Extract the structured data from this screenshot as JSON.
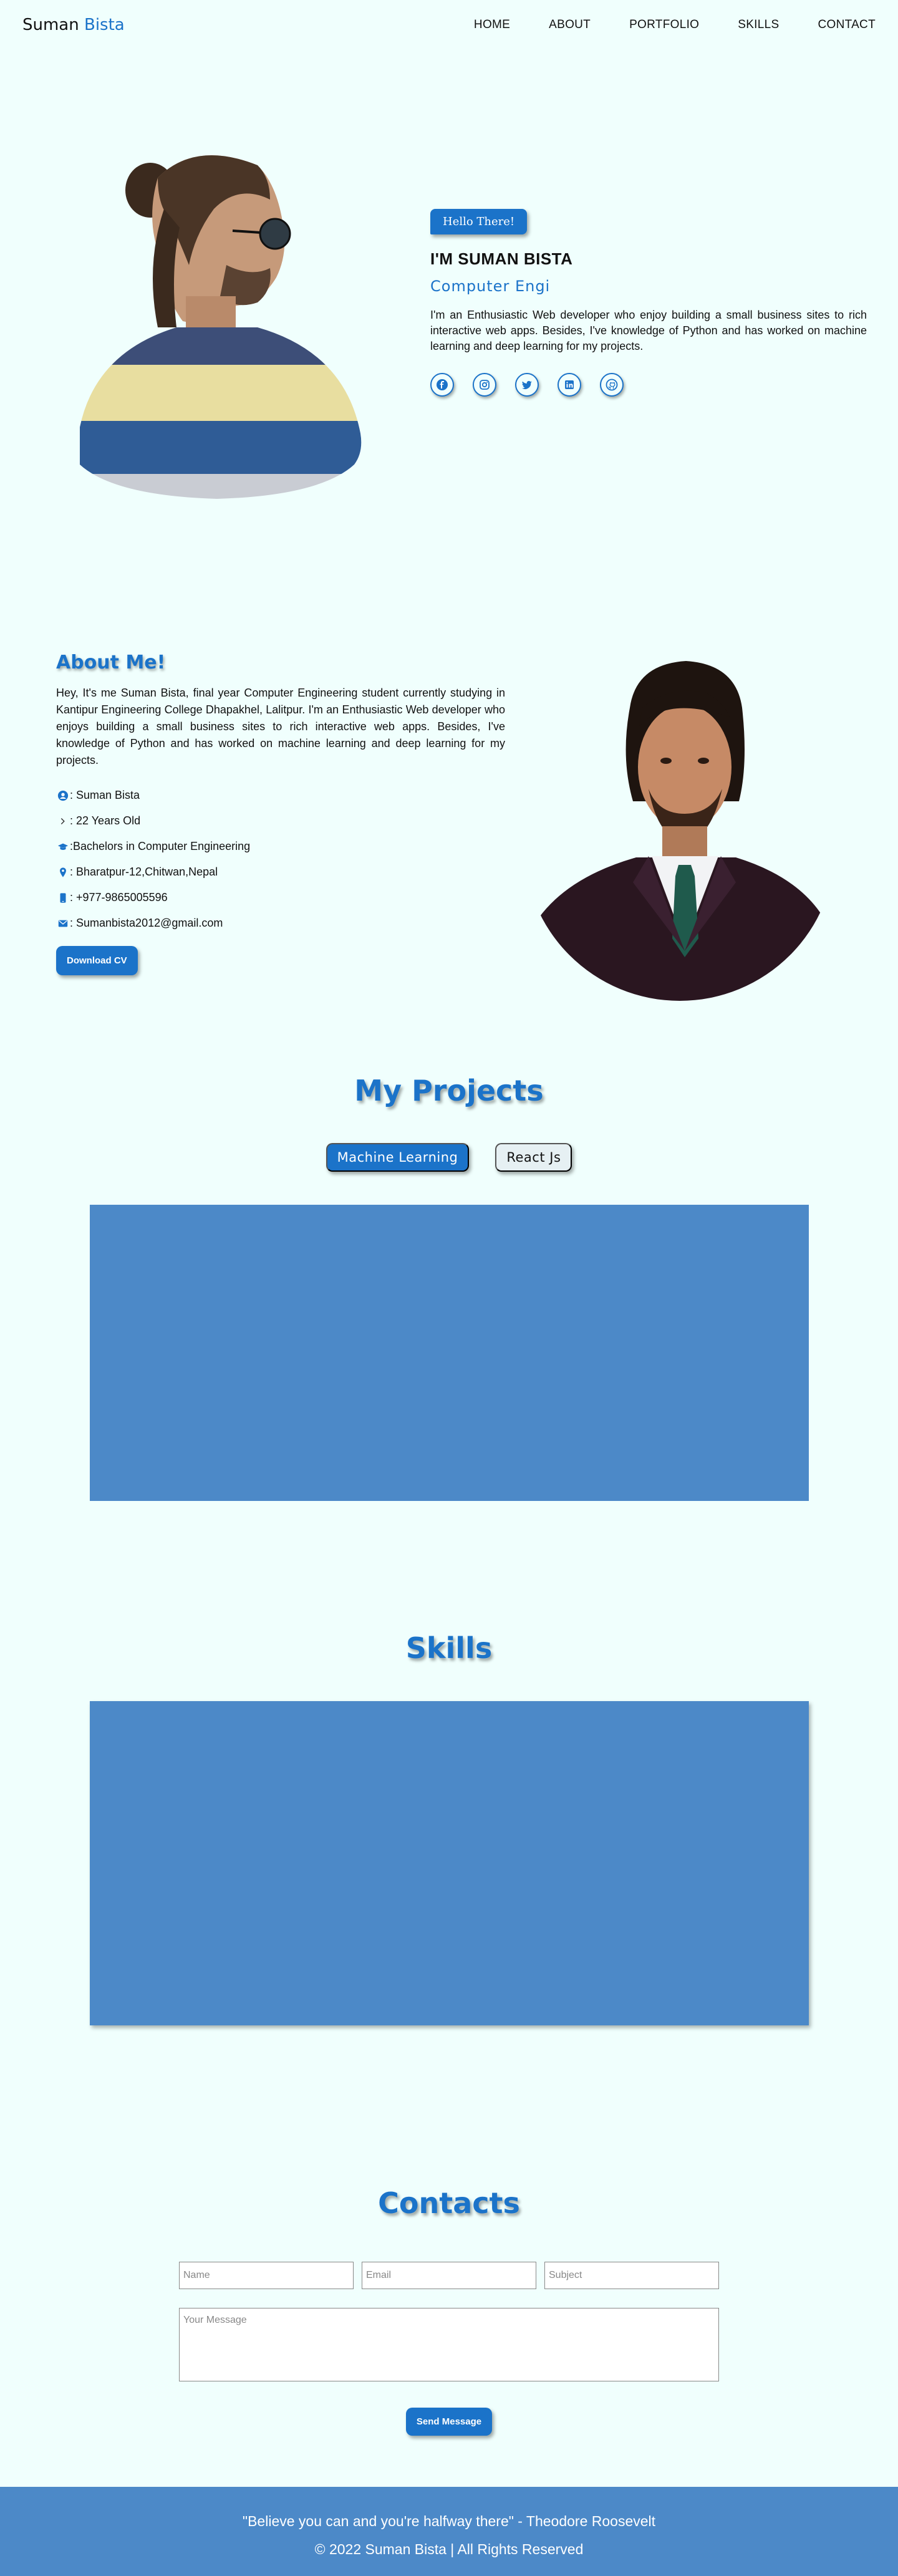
{
  "nav": {
    "brand_first": "Suman",
    "brand_last": "Bista",
    "links": [
      "HOME",
      "ABOUT",
      "PORTFOLIO",
      "SKILLS",
      "CONTACT"
    ]
  },
  "hero": {
    "greeting": "Hello There!",
    "name_line": "I'M SUMAN BISTA",
    "role_typed": "Computer Engi",
    "intro": "I'm an Enthusiastic Web developer who enjoy building a small business sites to rich interactive web apps. Besides, I've knowledge of Python and has worked on machine learning and deep learning for my projects.",
    "socials": [
      "facebook-icon",
      "instagram-icon",
      "twitter-icon",
      "linkedin-icon",
      "github-icon"
    ]
  },
  "about": {
    "title": "About Me!",
    "text": "Hey, It's me Suman Bista, final year Computer Engineering student currently studying in Kantipur Engineering College Dhapakhel, Lalitpur. I'm an Enthusiastic Web developer who enjoys building a small business sites to rich interactive web apps. Besides, I've knowledge of Python and has worked on machine learning and deep learning for my projects.",
    "facts": [
      ": Suman Bista",
      ": 22 Years Old",
      ":Bachelors in Computer Engineering",
      ": Bharatpur-12,Chitwan,Nepal",
      ": +977-9865005596",
      ": Sumanbista2012@gmail.com"
    ],
    "download_cv": "Download CV"
  },
  "projects": {
    "title": "My Projects",
    "tabs": [
      "Machine Learning",
      "React Js"
    ],
    "active_tab": "Machine Learning"
  },
  "skills": {
    "title": "Skills"
  },
  "contact": {
    "title": "Contacts",
    "name_placeholder": "Name",
    "email_placeholder": "Email",
    "subject_placeholder": "Subject",
    "message_placeholder": "Your Message",
    "send_label": "Send Message"
  },
  "footer": {
    "quote": "\"Believe you can and you're halfway there\" - Theodore Roosevelt",
    "copyright": "© 2022 Suman Bista | All Rights Reserved"
  },
  "colors": {
    "accent": "#1b73c9",
    "panel": "#4c89c8",
    "background": "#f0fffd"
  }
}
